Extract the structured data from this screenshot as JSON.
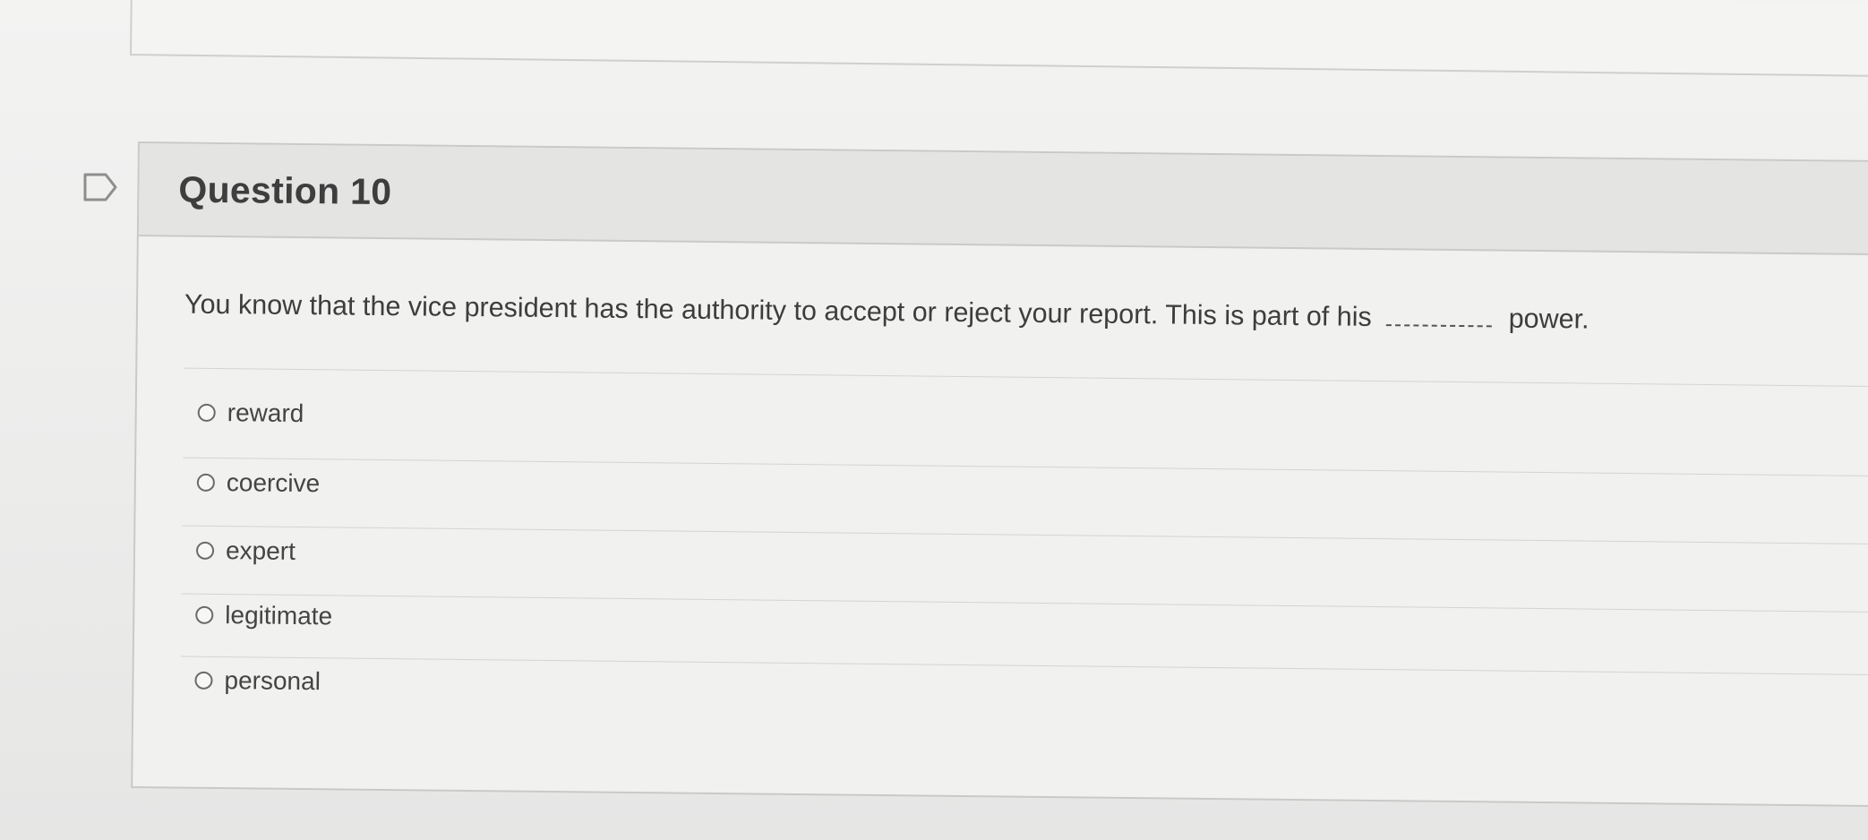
{
  "question": {
    "title": "Question 10",
    "text_before_blank": "You know that the vice president has the authority to accept or reject your report. This is part of his",
    "text_after_blank": "power.",
    "options": [
      {
        "label": "reward"
      },
      {
        "label": "coercive"
      },
      {
        "label": "expert"
      },
      {
        "label": "legitimate"
      },
      {
        "label": "personal"
      }
    ]
  },
  "icons": {
    "flag": "flag-icon",
    "radio": "radio-unselected-icon"
  },
  "colors": {
    "header_bg": "#e4e4e3",
    "text": "#3d3d3d",
    "border": "#c9c9c8"
  }
}
